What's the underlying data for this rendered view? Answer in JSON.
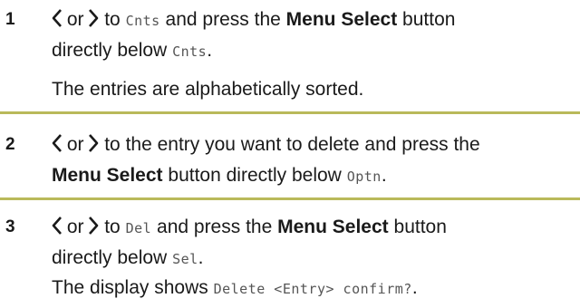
{
  "steps": [
    {
      "number": "1",
      "or_word": "or",
      "to_word": "to",
      "lcd_target": "Cnts",
      "press_text": "and press the",
      "button_name": "Menu Select",
      "button_word": "button",
      "directly_below": "directly below",
      "lcd_below": "Cnts",
      "period": ".",
      "note": "The entries are alphabetically sorted."
    },
    {
      "number": "2",
      "or_word": "or",
      "text_after_arrows": "to the entry you want to delete and press the",
      "button_name": "Menu Select",
      "directly_below": "button directly below",
      "lcd_below": "Optn",
      "period": "."
    },
    {
      "number": "3",
      "or_word": "or",
      "to_word": "to",
      "lcd_target": "Del",
      "press_text": "and press the",
      "button_name": "Menu Select",
      "button_word": "button",
      "directly_below": "directly below",
      "lcd_below": "Sel",
      "period": ".",
      "display_text": "The display shows",
      "lcd_display": "Delete <Entry> confirm?",
      "display_period": "."
    }
  ],
  "icons": {
    "left": "scroll-left-icon",
    "right": "scroll-right-icon"
  },
  "colors": {
    "divider": "#b9b95a",
    "text": "#1a1a1a",
    "lcd_text": "#555555"
  }
}
